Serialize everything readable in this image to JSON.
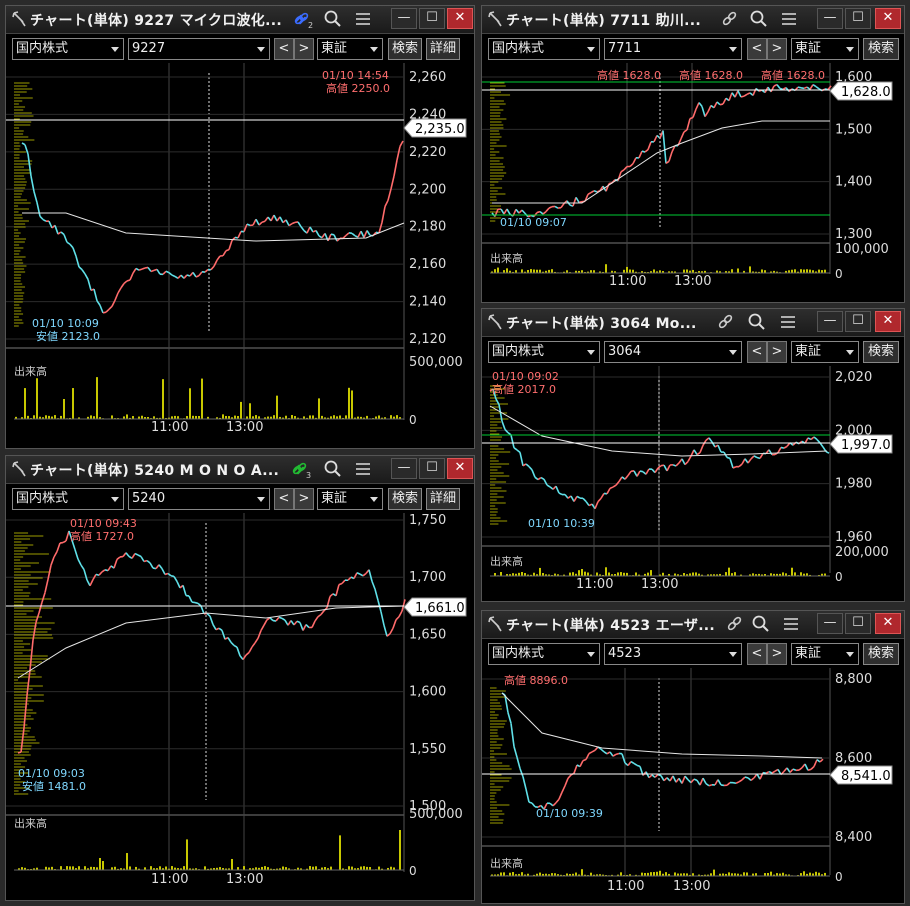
{
  "common": {
    "market": "国内株式",
    "exchange": "東証",
    "prev": "<",
    "next": ">",
    "search": "検索",
    "detail": "詳細",
    "volume_label": "出来高",
    "time_labels": [
      "11:00",
      "13:00"
    ]
  },
  "windows": [
    {
      "title": "チャート(単体) 9227 マイクロ波化...",
      "link_badge": "2",
      "code": "9227",
      "has_detail": true,
      "high_time": "01/10 14:54",
      "high_label": "高値 2250.0",
      "low_time": "01/10 10:09",
      "low_label": "安値 2123.0",
      "price_ticks": [
        "2,260",
        "2,240",
        "2,220",
        "2,200",
        "2,180",
        "2,160",
        "2,140",
        "2,120"
      ],
      "current_price": "2,235.0",
      "volume_tick": "500,000",
      "volume_zero": "0"
    },
    {
      "title": "チャート(単体) 7711 助川...",
      "code": "7711",
      "has_detail": false,
      "high_labels": [
        "高値 1628.0",
        "高値 1628.0",
        "高値 1628.0"
      ],
      "low_time": "01/10 09:07",
      "price_ticks": [
        "1,600",
        "1,500",
        "1,400",
        "1,300"
      ],
      "current_price": "1,628.0",
      "volume_tick": "100,000",
      "volume_zero": "0"
    },
    {
      "title": "チャート(単体) 3064 Mo...",
      "code": "3064",
      "has_detail": false,
      "high_time": "01/10 09:02",
      "high_label": "高値 2017.0",
      "low_time": "01/10 10:39",
      "price_ticks": [
        "2,020",
        "2,000",
        "1,980",
        "1,960"
      ],
      "current_price": "1,997.0",
      "volume_tick": "200,000",
      "volume_zero": "0"
    },
    {
      "title": "チャート(単体) 5240 M O N O A...",
      "link_badge": "3",
      "code": "5240",
      "has_detail": true,
      "high_time": "01/10 09:43",
      "high_label": "高値 1727.0",
      "low_time": "01/10 09:03",
      "low_label": "安値 1481.0",
      "price_ticks": [
        "1,750",
        "1,700",
        "1,650",
        "1,600",
        "1,550",
        "1,500"
      ],
      "current_price": "1,661.0",
      "volume_tick": "500,000",
      "volume_zero": "0"
    },
    {
      "title": "チャート(単体) 4523 エーザ...",
      "code": "4523",
      "has_detail": false,
      "high_label": "高値 8896.0",
      "low_time": "01/10 09:39",
      "price_ticks": [
        "8,800",
        "8,600",
        "8,400"
      ],
      "current_price": "8,541.0",
      "volume_tick": "",
      "volume_zero": "0"
    }
  ],
  "colors": {
    "up": "#ff6b6b",
    "down": "#5fe0e8",
    "vwap": "#e6e6e6",
    "high_text": "#ff6e6e",
    "low_text": "#7fd8ff",
    "volume": "#c8c800",
    "green_line": "#00cc33"
  }
}
